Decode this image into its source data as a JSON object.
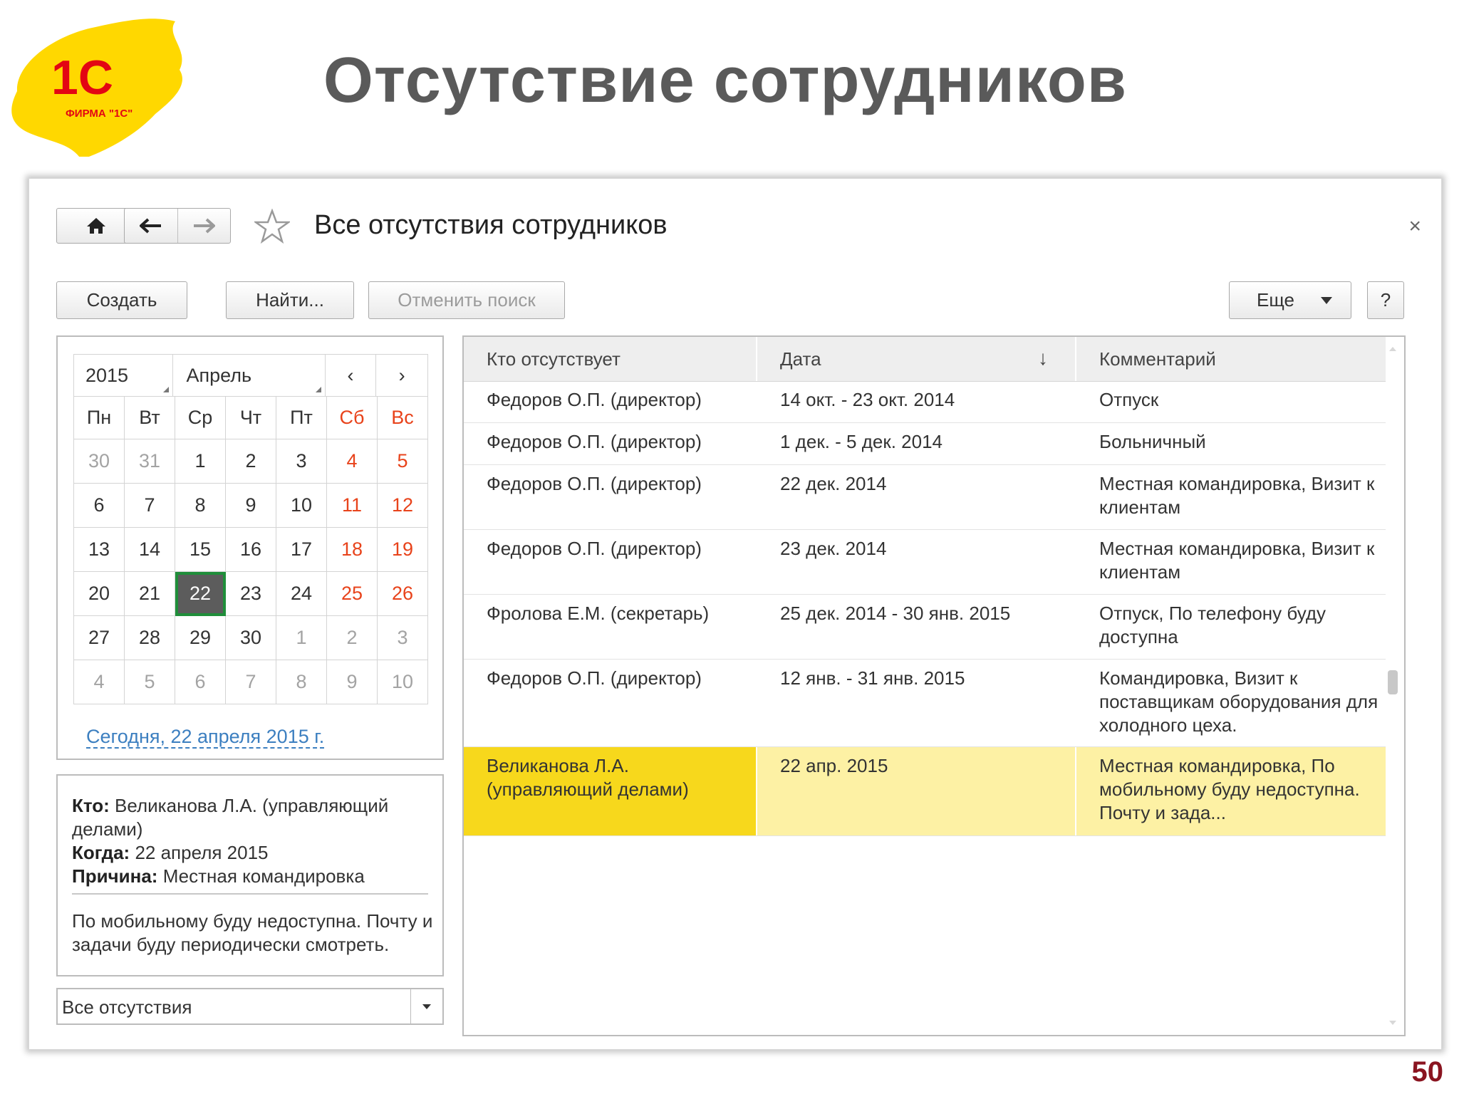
{
  "slide": {
    "title": "Отсутствие сотрудников",
    "page_number": "50",
    "logo": {
      "text": "1С",
      "subtext": "ФИРМА \"1С\"",
      "color": "#ffd800",
      "brand_red": "#e30613"
    }
  },
  "form": {
    "title": "Все отсутствия сотрудников",
    "close_icon": "×",
    "nav": {
      "home_icon": "home-icon",
      "back_icon": "arrow-left-icon",
      "forward_icon": "arrow-right-icon",
      "favorite_icon": "star-icon"
    }
  },
  "toolbar": {
    "create": "Создать",
    "find": "Найти...",
    "cancel_search": "Отменить поиск",
    "more": "Еще",
    "help": "?"
  },
  "calendar": {
    "year": "2015",
    "month": "Апрель",
    "prev": "‹",
    "next": "›",
    "weekdays": [
      "Пн",
      "Вт",
      "Ср",
      "Чт",
      "Пт",
      "Сб",
      "Вс"
    ],
    "weeks": [
      [
        "30",
        "31",
        "1",
        "2",
        "3",
        "4",
        "5"
      ],
      [
        "6",
        "7",
        "8",
        "9",
        "10",
        "11",
        "12"
      ],
      [
        "13",
        "14",
        "15",
        "16",
        "17",
        "18",
        "19"
      ],
      [
        "20",
        "21",
        "22",
        "23",
        "24",
        "25",
        "26"
      ],
      [
        "27",
        "28",
        "29",
        "30",
        "1",
        "2",
        "3"
      ],
      [
        "4",
        "5",
        "6",
        "7",
        "8",
        "9",
        "10"
      ]
    ],
    "selected_day": "22",
    "today_link": "Сегодня, 22 апреля 2015 г."
  },
  "details": {
    "who_label": "Кто:",
    "who_value": "Великанова Л.А. (управляющий делами)",
    "when_label": "Когда:",
    "when_value": "22 апреля 2015",
    "reason_label": "Причина:",
    "reason_value": "Местная командировка",
    "note": "По мобильному буду недоступна. Почту и задачи буду периодически смотреть."
  },
  "filter": {
    "value": "Все отсутствия"
  },
  "table": {
    "columns": [
      "Кто отсутствует",
      "Дата",
      "Комментарий"
    ],
    "sort_icon": "↓",
    "rows": [
      {
        "who": "Федоров О.П. (директор)",
        "date": "14 окт. - 23 окт. 2014",
        "comment": "Отпуск"
      },
      {
        "who": "Федоров О.П. (директор)",
        "date": "1 дек. - 5 дек. 2014",
        "comment": "Больничный"
      },
      {
        "who": "Федоров О.П. (директор)",
        "date": "22 дек. 2014",
        "comment": "Местная командировка, Визит к клиентам"
      },
      {
        "who": "Федоров О.П. (директор)",
        "date": "23 дек. 2014",
        "comment": "Местная командировка, Визит к клиентам"
      },
      {
        "who": "Фролова Е.М. (секретарь)",
        "date": "25 дек. 2014 - 30 янв. 2015",
        "comment": "Отпуск, По телефону буду доступна"
      },
      {
        "who": "Федоров О.П. (директор)",
        "date": "12 янв. - 31 янв. 2015",
        "comment": "Командировка, Визит к поставщикам оборудования для холодного цеха."
      },
      {
        "who": "Великанова Л.А. (управляющий делами)",
        "date": "22 апр. 2015",
        "comment": "Местная командировка, По мобильному буду недоступна. Почту и зада..."
      }
    ]
  }
}
